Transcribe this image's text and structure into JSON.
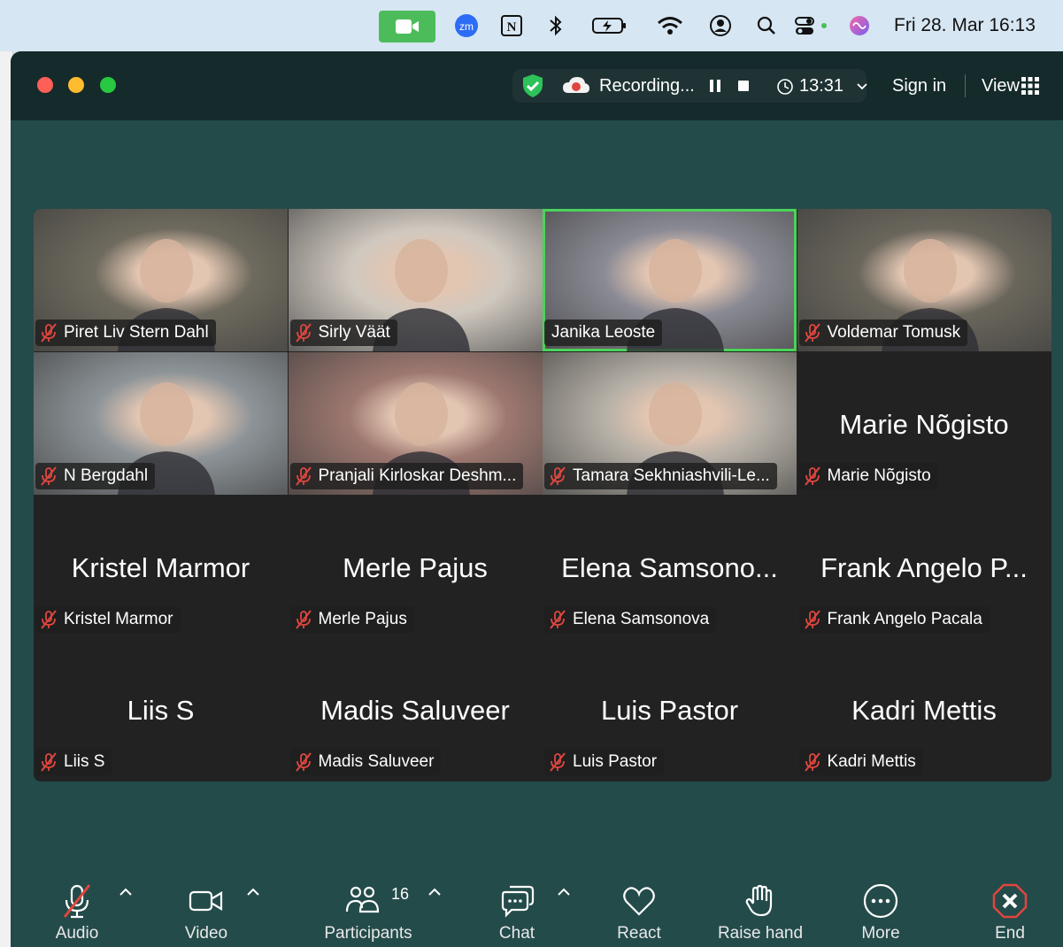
{
  "menubar": {
    "clock": "Fri 28. Mar  16:13",
    "icons": [
      "zoom-video-icon",
      "zoom-zm-icon",
      "notion-icon",
      "bluetooth-icon",
      "battery-icon",
      "wifi-icon",
      "user-account-icon",
      "spotlight-search-icon",
      "control-center-icon",
      "siri-icon"
    ]
  },
  "titlebar": {
    "recording_label": "Recording...",
    "time": "13:31",
    "sign_in": "Sign in",
    "view": "View"
  },
  "tiles": [
    {
      "name": "Piret Liv Stern Dahl",
      "video": true,
      "bg": "#6e6a5e"
    },
    {
      "name": "Sirly Väät",
      "video": true,
      "bg": "#cfc8bf"
    },
    {
      "name": "Janika Leoste",
      "video": true,
      "bg": "#8a8a94",
      "active": true
    },
    {
      "name": "Voldemar Tomusk",
      "video": true,
      "bg": "#6a665c"
    },
    {
      "name": "N Bergdahl",
      "video": true,
      "bg": "#8d9498"
    },
    {
      "name": "Pranjali Kirloskar Deshm...",
      "video": true,
      "bg": "#9d7870"
    },
    {
      "name": "Tamara Sekhniashvili-Le...",
      "video": true,
      "bg": "#b6b0a7"
    },
    {
      "name": "Marie Nõgisto",
      "big": "Marie Nõgisto",
      "video": false
    },
    {
      "name": "Kristel Marmor",
      "big": "Kristel Marmor",
      "video": false
    },
    {
      "name": "Merle Pajus",
      "big": "Merle Pajus",
      "video": false
    },
    {
      "name": "Elena Samsonova",
      "big": "Elena Samsono...",
      "video": false
    },
    {
      "name": "Frank Angelo Pacala",
      "big": "Frank Angelo P...",
      "video": false
    },
    {
      "name": "Liis S",
      "big": "Liis S",
      "video": false
    },
    {
      "name": "Madis Saluveer",
      "big": "Madis Saluveer",
      "video": false
    },
    {
      "name": "Luis Pastor",
      "big": "Luis Pastor",
      "video": false
    },
    {
      "name": "Kadri Mettis",
      "big": "Kadri Mettis",
      "video": false
    }
  ],
  "toolbar": {
    "audio": "Audio",
    "video": "Video",
    "participants": "Participants",
    "participants_count": "16",
    "chat": "Chat",
    "react": "React",
    "raise_hand": "Raise hand",
    "more": "More",
    "end": "End"
  },
  "colors": {
    "active_speaker": "#4cd35a",
    "muted_red": "#e0463f",
    "end_red": "#e0463f",
    "zoom_green": "#4cbc5b"
  }
}
